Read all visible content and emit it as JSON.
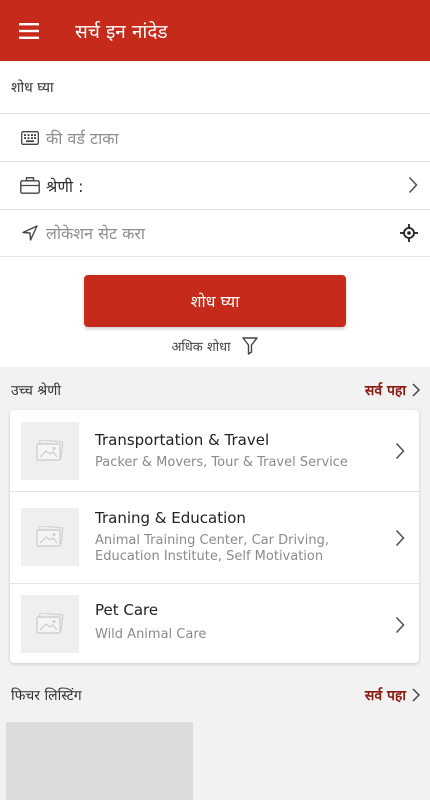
{
  "appbar": {
    "title": "सर्च इन नांदेड",
    "menu_icon": "menu-icon"
  },
  "search": {
    "section_label": "शोध घ्या",
    "keyword_placeholder": "की वर्ड टाका",
    "category_label": "श्रेणी :",
    "location_placeholder": "लोकेशन सेट करा",
    "search_button": "शोध घ्या",
    "advanced_label": "अधिक शोधा"
  },
  "top_categories": {
    "title": "उच्च श्रेणी",
    "see_all": "सर्व पहा",
    "items": [
      {
        "title": "Transportation & Travel",
        "subtitle": "Packer & Movers, Tour & Travel Service"
      },
      {
        "title": "Traning & Education",
        "subtitle": "Animal Training Center, Car Driving, Education Institute, Self Motivation"
      },
      {
        "title": "Pet Care",
        "subtitle": "Wild Animal Care"
      }
    ]
  },
  "featured": {
    "title": "फिचर लिस्टिंग",
    "see_all": "सर्व पहा"
  },
  "colors": {
    "brand": "#c62a1a",
    "see_all": "#8a1a10"
  }
}
